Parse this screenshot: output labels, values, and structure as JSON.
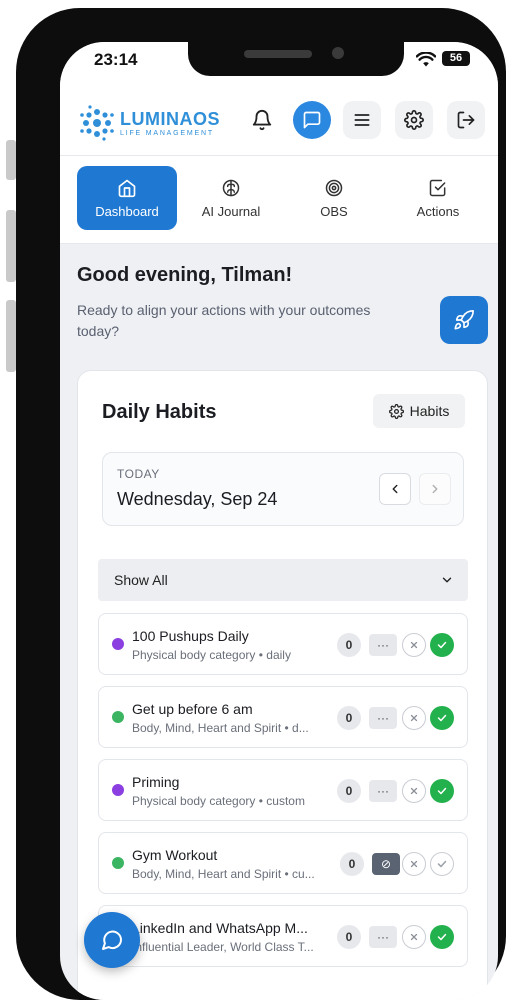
{
  "status": {
    "time": "23:14",
    "battery": "56"
  },
  "brand": {
    "name": "LUMINAOS",
    "tagline": "LIFE MANAGEMENT"
  },
  "tabs": [
    {
      "label": "Dashboard",
      "icon": "home-icon",
      "active": true
    },
    {
      "label": "AI Journal",
      "icon": "brain-icon",
      "active": false
    },
    {
      "label": "OBS",
      "icon": "target-icon",
      "active": false
    },
    {
      "label": "Actions",
      "icon": "checkbox-icon",
      "active": false
    }
  ],
  "greeting": {
    "title": "Good evening, Tilman!",
    "subtitle": "Ready to align your actions with your outcomes today?"
  },
  "habits_card": {
    "title": "Daily Habits",
    "habits_button": "Habits",
    "date_label": "TODAY",
    "date_value": "Wednesday, Sep 24",
    "filter": "Show All"
  },
  "habits": [
    {
      "name": "100 Pushups Daily",
      "meta": "Physical body category • daily",
      "count": "0",
      "more": "···",
      "dot_color": "#8b3fe0",
      "done": true
    },
    {
      "name": "Get up before 6 am",
      "meta": "Body, Mind, Heart and Spirit • d...",
      "count": "0",
      "more": "···",
      "dot_color": "#3cb563",
      "done": true
    },
    {
      "name": "Priming",
      "meta": "Physical body category • custom",
      "count": "0",
      "more": "···",
      "dot_color": "#8b3fe0",
      "done": true
    },
    {
      "name": "Gym Workout",
      "meta": "Body, Mind, Heart and Spirit • cu...",
      "count": "0",
      "more": "⊘",
      "dot_color": "#3cb563",
      "done": false
    },
    {
      "name": "LinkedIn and WhatsApp M...",
      "meta": "Influential Leader, World Class T...",
      "count": "0",
      "more": "···",
      "dot_color": "#3cb563",
      "done": true
    }
  ],
  "colors": {
    "primary": "#1f78d1",
    "success": "#22b14c",
    "purple": "#8b3fe0",
    "green": "#3cb563"
  }
}
